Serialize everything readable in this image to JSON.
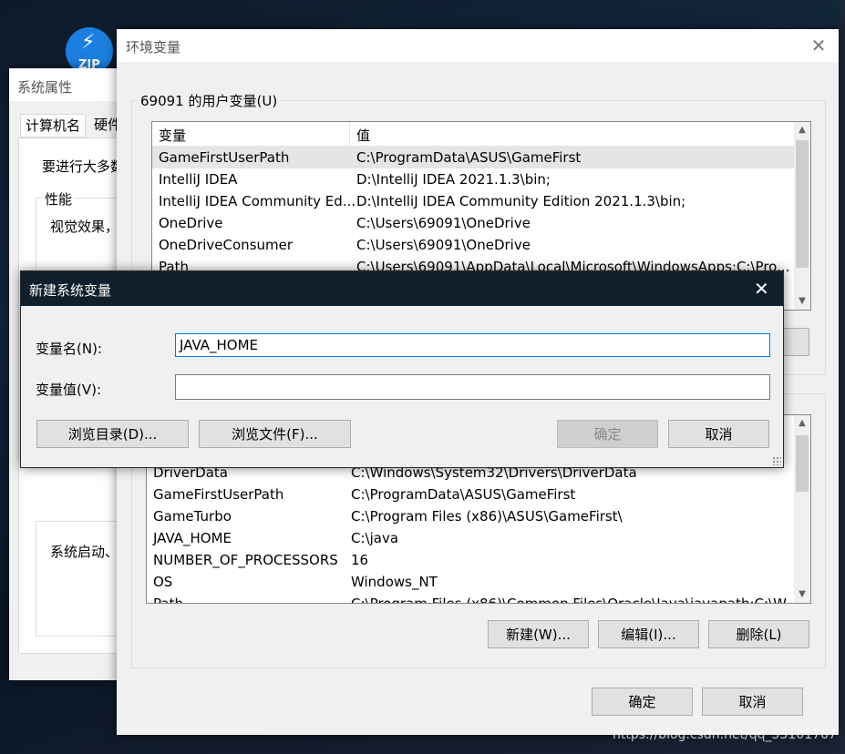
{
  "background": {
    "watermark": "https://blog.csdn.net/qq_53101767",
    "zip_label": "ZIP"
  },
  "sysprops": {
    "title": "系统属性",
    "tabs": [
      "计算机名",
      "硬件"
    ],
    "intro": "要进行大多数",
    "perf_group": "性能",
    "perf_text": "视觉效果，",
    "startup_text": "系统启动、"
  },
  "envvars": {
    "title": "环境变量",
    "close": "✕",
    "user_group": "69091 的用户变量(U)",
    "col_var": "变量",
    "col_val": "值",
    "user_rows": [
      {
        "name": "GameFirstUserPath",
        "value": "C:\\ProgramData\\ASUS\\GameFirst"
      },
      {
        "name": "IntelliJ IDEA",
        "value": "D:\\IntelliJ IDEA 2021.1.3\\bin;"
      },
      {
        "name": "IntelliJ IDEA Community Ed...",
        "value": "D:\\IntelliJ IDEA Community Edition 2021.1.3\\bin;"
      },
      {
        "name": "OneDrive",
        "value": "C:\\Users\\69091\\OneDrive"
      },
      {
        "name": "OneDriveConsumer",
        "value": "C:\\Users\\69091\\OneDrive"
      },
      {
        "name": "Path",
        "value": "C:\\Users\\69091\\AppData\\Local\\Microsoft\\WindowsApps;C:\\Pro..."
      }
    ],
    "sys_rows": [
      {
        "name": "DriverData",
        "value": "C:\\Windows\\System32\\Drivers\\DriverData"
      },
      {
        "name": "GameFirstUserPath",
        "value": "C:\\ProgramData\\ASUS\\GameFirst"
      },
      {
        "name": "GameTurbo",
        "value": "C:\\Program Files (x86)\\ASUS\\GameFirst\\"
      },
      {
        "name": "JAVA_HOME",
        "value": "C:\\java"
      },
      {
        "name": "NUMBER_OF_PROCESSORS",
        "value": "16"
      },
      {
        "name": "OS",
        "value": "Windows_NT"
      },
      {
        "name": "Path",
        "value": "C:\\Program Files (x86)\\Common Files\\Oracle\\Java\\javapath;C:\\W..."
      }
    ],
    "new_btn": "新建(W)...",
    "edit_btn": "编辑(I)...",
    "delete_btn": "删除(L)",
    "ok_btn": "确定",
    "cancel_btn": "取消"
  },
  "newvar": {
    "title": "新建系统变量",
    "close": "✕",
    "name_label": "变量名(N):",
    "name_value": "JAVA_HOME",
    "value_label": "变量值(V):",
    "value_value": "",
    "browse_dir_btn": "浏览目录(D)...",
    "browse_file_btn": "浏览文件(F)...",
    "ok_btn": "确定",
    "cancel_btn": "取消"
  }
}
